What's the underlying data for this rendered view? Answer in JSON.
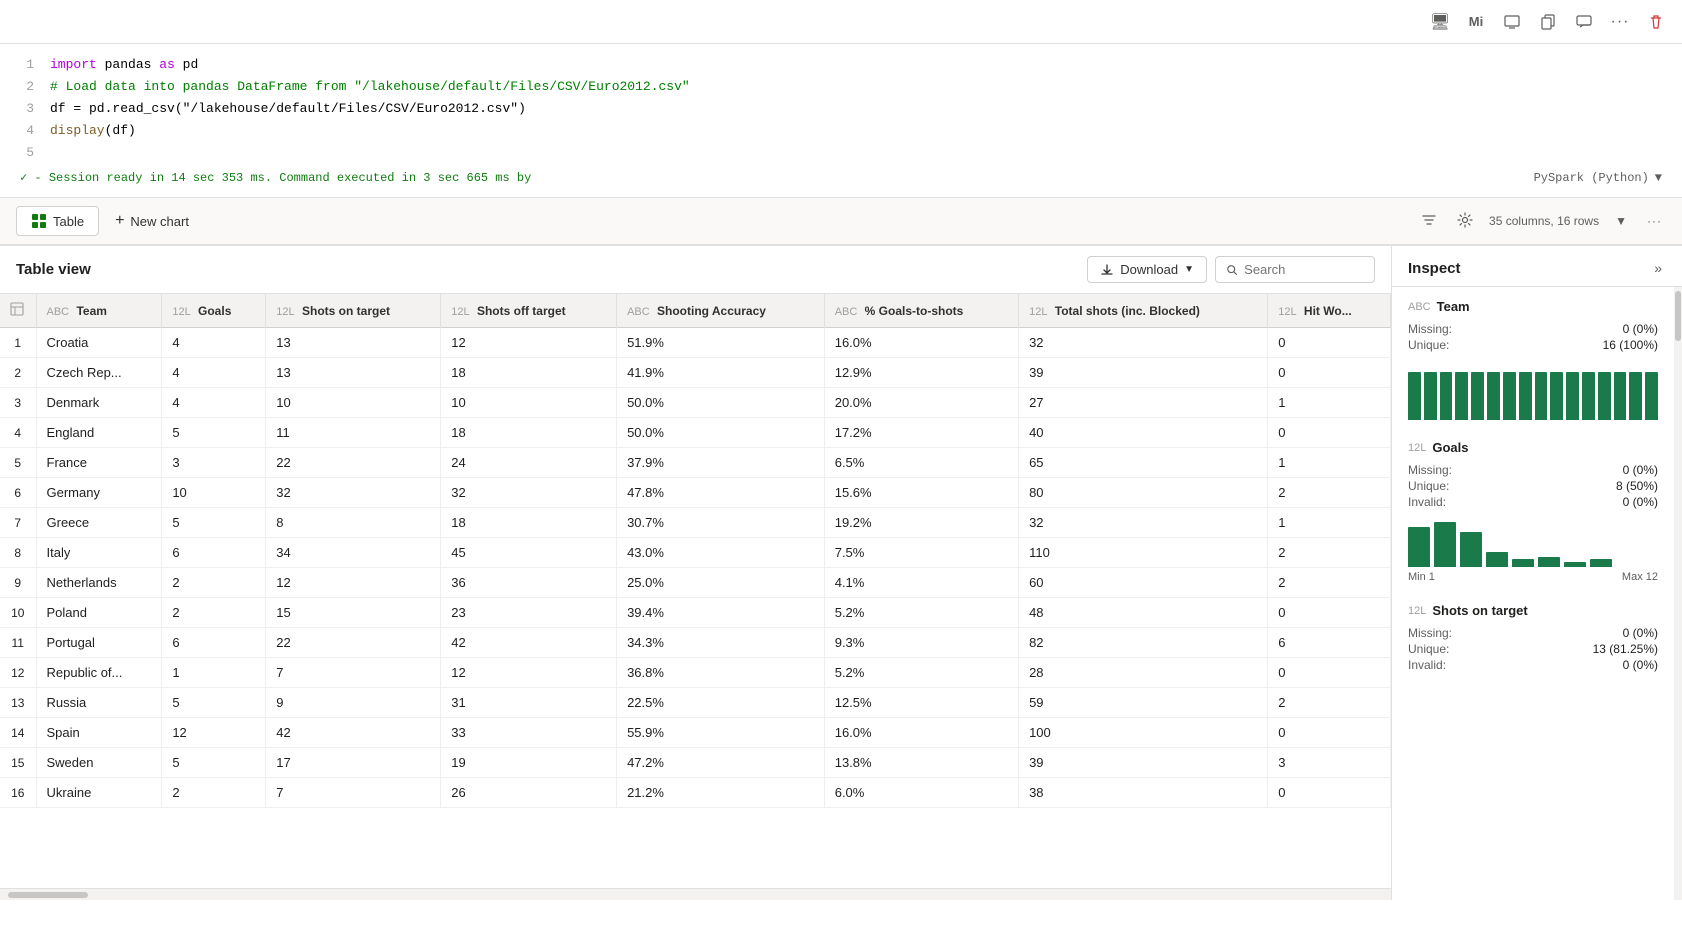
{
  "toolbar": {
    "icons": [
      "monitor-icon",
      "person-icon",
      "screen-icon",
      "copy-icon",
      "chat-icon",
      "more-icon",
      "delete-icon"
    ]
  },
  "code_cell": {
    "lines": [
      {
        "num": 1,
        "parts": [
          {
            "type": "kw",
            "text": "import"
          },
          {
            "type": "plain",
            "text": " pandas "
          },
          {
            "type": "kw",
            "text": "as"
          },
          {
            "type": "plain",
            "text": " pd"
          }
        ]
      },
      {
        "num": 2,
        "parts": [
          {
            "type": "cm",
            "text": "# Load data into pandas DataFrame from \"/lakehouse/default/Files/CSV/Euro2012.csv\""
          }
        ]
      },
      {
        "num": 3,
        "parts": [
          {
            "type": "plain",
            "text": "df = pd.read_csv(\"/lakehouse/default/Files/CSV/Euro2012.csv\")"
          }
        ]
      },
      {
        "num": 4,
        "parts": [
          {
            "type": "fn",
            "text": "display"
          },
          {
            "type": "plain",
            "text": "(df)"
          }
        ]
      },
      {
        "num": 5,
        "parts": [
          {
            "type": "plain",
            "text": ""
          }
        ]
      }
    ],
    "status": "✓  - Session ready in 14 sec 353 ms. Command executed in 3 sec 665 ms by",
    "engine": "PySpark (Python)"
  },
  "tabs": {
    "table_label": "Table",
    "new_chart_label": "New chart",
    "columns_info": "35 columns, 16 rows"
  },
  "table_view": {
    "title": "Table view",
    "download_label": "Download",
    "search_placeholder": "Search",
    "columns": [
      {
        "type": "ABC",
        "name": "Team"
      },
      {
        "type": "12L",
        "name": "Goals"
      },
      {
        "type": "12L",
        "name": "Shots on target"
      },
      {
        "type": "12L",
        "name": "Shots off target"
      },
      {
        "type": "ABC",
        "name": "Shooting Accuracy"
      },
      {
        "type": "ABC",
        "name": "% Goals-to-shots"
      },
      {
        "type": "12L",
        "name": "Total shots (inc. Blocked)"
      },
      {
        "type": "12L",
        "name": "Hit Wo..."
      }
    ],
    "rows": [
      {
        "idx": 1,
        "team": "Croatia",
        "goals": 4,
        "shots_on": 13,
        "shots_off": 12,
        "shoot_acc": "51.9%",
        "goals_shots": "16.0%",
        "total_shots": 32,
        "hit_wo": 0
      },
      {
        "idx": 2,
        "team": "Czech Rep...",
        "goals": 4,
        "shots_on": 13,
        "shots_off": 18,
        "shoot_acc": "41.9%",
        "goals_shots": "12.9%",
        "total_shots": 39,
        "hit_wo": 0
      },
      {
        "idx": 3,
        "team": "Denmark",
        "goals": 4,
        "shots_on": 10,
        "shots_off": 10,
        "shoot_acc": "50.0%",
        "goals_shots": "20.0%",
        "total_shots": 27,
        "hit_wo": 1
      },
      {
        "idx": 4,
        "team": "England",
        "goals": 5,
        "shots_on": 11,
        "shots_off": 18,
        "shoot_acc": "50.0%",
        "goals_shots": "17.2%",
        "total_shots": 40,
        "hit_wo": 0
      },
      {
        "idx": 5,
        "team": "France",
        "goals": 3,
        "shots_on": 22,
        "shots_off": 24,
        "shoot_acc": "37.9%",
        "goals_shots": "6.5%",
        "total_shots": 65,
        "hit_wo": 1
      },
      {
        "idx": 6,
        "team": "Germany",
        "goals": 10,
        "shots_on": 32,
        "shots_off": 32,
        "shoot_acc": "47.8%",
        "goals_shots": "15.6%",
        "total_shots": 80,
        "hit_wo": 2
      },
      {
        "idx": 7,
        "team": "Greece",
        "goals": 5,
        "shots_on": 8,
        "shots_off": 18,
        "shoot_acc": "30.7%",
        "goals_shots": "19.2%",
        "total_shots": 32,
        "hit_wo": 1
      },
      {
        "idx": 8,
        "team": "Italy",
        "goals": 6,
        "shots_on": 34,
        "shots_off": 45,
        "shoot_acc": "43.0%",
        "goals_shots": "7.5%",
        "total_shots": 110,
        "hit_wo": 2
      },
      {
        "idx": 9,
        "team": "Netherlands",
        "goals": 2,
        "shots_on": 12,
        "shots_off": 36,
        "shoot_acc": "25.0%",
        "goals_shots": "4.1%",
        "total_shots": 60,
        "hit_wo": 2
      },
      {
        "idx": 10,
        "team": "Poland",
        "goals": 2,
        "shots_on": 15,
        "shots_off": 23,
        "shoot_acc": "39.4%",
        "goals_shots": "5.2%",
        "total_shots": 48,
        "hit_wo": 0
      },
      {
        "idx": 11,
        "team": "Portugal",
        "goals": 6,
        "shots_on": 22,
        "shots_off": 42,
        "shoot_acc": "34.3%",
        "goals_shots": "9.3%",
        "total_shots": 82,
        "hit_wo": 6
      },
      {
        "idx": 12,
        "team": "Republic of...",
        "goals": 1,
        "shots_on": 7,
        "shots_off": 12,
        "shoot_acc": "36.8%",
        "goals_shots": "5.2%",
        "total_shots": 28,
        "hit_wo": 0
      },
      {
        "idx": 13,
        "team": "Russia",
        "goals": 5,
        "shots_on": 9,
        "shots_off": 31,
        "shoot_acc": "22.5%",
        "goals_shots": "12.5%",
        "total_shots": 59,
        "hit_wo": 2
      },
      {
        "idx": 14,
        "team": "Spain",
        "goals": 12,
        "shots_on": 42,
        "shots_off": 33,
        "shoot_acc": "55.9%",
        "goals_shots": "16.0%",
        "total_shots": 100,
        "hit_wo": 0
      },
      {
        "idx": 15,
        "team": "Sweden",
        "goals": 5,
        "shots_on": 17,
        "shots_off": 19,
        "shoot_acc": "47.2%",
        "goals_shots": "13.8%",
        "total_shots": 39,
        "hit_wo": 3
      },
      {
        "idx": 16,
        "team": "Ukraine",
        "goals": 2,
        "shots_on": 7,
        "shots_off": 26,
        "shoot_acc": "21.2%",
        "goals_shots": "6.0%",
        "total_shots": 38,
        "hit_wo": 0
      }
    ]
  },
  "inspect": {
    "title": "Inspect",
    "expand_icon": "»",
    "sections": [
      {
        "col_type": "ABC",
        "col_name": "Team",
        "stats": [
          {
            "label": "Missing:",
            "value": "0 (0%)"
          },
          {
            "label": "Unique:",
            "value": "16 (100%)"
          }
        ],
        "chart_type": "bar_equal",
        "bar_count": 16
      },
      {
        "col_type": "12L",
        "col_name": "Goals",
        "stats": [
          {
            "label": "Missing:",
            "value": "0 (0%)"
          },
          {
            "label": "Unique:",
            "value": "8 (50%)"
          },
          {
            "label": "Invalid:",
            "value": "0 (0%)"
          }
        ],
        "chart_type": "bar_histogram",
        "min": "Min 1",
        "max": "Max 12"
      },
      {
        "col_type": "12L",
        "col_name": "Shots on target",
        "stats": [
          {
            "label": "Missing:",
            "value": "0 (0%)"
          },
          {
            "label": "Unique:",
            "value": "13 (81.25%)"
          },
          {
            "label": "Invalid:",
            "value": "0 (0%)"
          }
        ],
        "chart_type": "bar_histogram"
      }
    ]
  }
}
